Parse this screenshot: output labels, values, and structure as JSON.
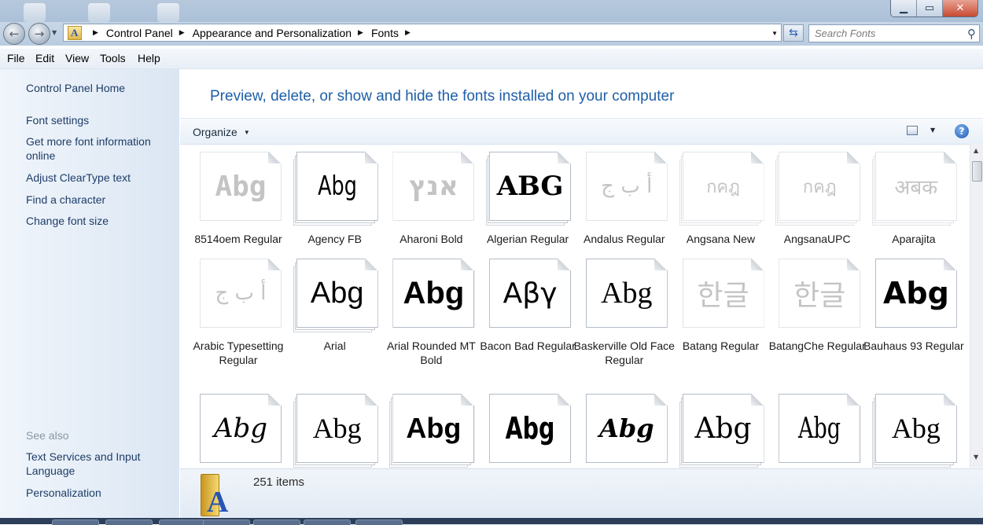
{
  "window_buttons": {
    "minimize": "▁",
    "maximize": "▭",
    "close": "✕"
  },
  "nav": {
    "back_glyph": "←",
    "forward_glyph": "→",
    "breadcrumbs": [
      "Control Panel",
      "Appearance and Personalization",
      "Fonts"
    ],
    "search_placeholder": "Search Fonts"
  },
  "menu": [
    "File",
    "Edit",
    "View",
    "Tools",
    "Help"
  ],
  "sidebar": {
    "home": "Control Panel Home",
    "links": [
      "Font settings",
      "Get more font information online",
      "Adjust ClearType text",
      "Find a character",
      "Change font size"
    ],
    "see_also_label": "See also",
    "see_also": [
      "Text Services and Input Language",
      "Personalization"
    ]
  },
  "main": {
    "title": "Preview, delete, or show and hide the fonts installed on your computer",
    "organize_label": "Organize",
    "help_glyph": "?"
  },
  "fonts": [
    {
      "name": "8514oem Regular",
      "sample": "Abg",
      "faded": true,
      "family": "\"DejaVu Sans Mono\", monospace",
      "size": 36,
      "weight": "bold",
      "style": "normal",
      "stack": false
    },
    {
      "name": "Agency FB",
      "sample": "Abg",
      "faded": false,
      "family": "\"DejaVu Sans\", sans-serif",
      "size": 34,
      "weight": "normal",
      "style": "normal",
      "condensed": true,
      "stack": true
    },
    {
      "name": "Aharoni Bold",
      "sample": "אנץ",
      "faded": true,
      "family": "\"DejaVu Sans\", sans-serif",
      "size": 34,
      "weight": "bold",
      "style": "normal",
      "stack": false
    },
    {
      "name": "Algerian Regular",
      "sample": "ABG",
      "faded": false,
      "family": "\"DejaVu Serif\", serif",
      "size": 34,
      "weight": "bold",
      "style": "normal",
      "stack": true
    },
    {
      "name": "Andalus Regular",
      "sample": "أ ب ج",
      "faded": true,
      "family": "\"DejaVu Serif\", serif",
      "size": 26,
      "weight": "normal",
      "style": "normal",
      "stack": false
    },
    {
      "name": "Angsana New",
      "sample": "กคฎ",
      "faded": true,
      "family": "\"DejaVu Sans\", sans-serif",
      "size": 22,
      "weight": "normal",
      "style": "normal",
      "stack": true
    },
    {
      "name": "AngsanaUPC",
      "sample": "กคฎ",
      "faded": true,
      "family": "\"DejaVu Sans\", sans-serif",
      "size": 22,
      "weight": "normal",
      "style": "normal",
      "stack": true
    },
    {
      "name": "Aparajita",
      "sample": "अबक",
      "faded": true,
      "family": "\"DejaVu Serif\", serif",
      "size": 26,
      "weight": "normal",
      "style": "normal",
      "stack": true
    },
    {
      "name": "Arabic Typesetting Regular",
      "sample": "أ ب ج",
      "faded": true,
      "family": "\"DejaVu Serif\", serif",
      "size": 26,
      "weight": "normal",
      "style": "normal",
      "stack": false
    },
    {
      "name": "Arial",
      "sample": "Abg",
      "faded": false,
      "family": "\"Liberation Sans\", sans-serif",
      "size": 38,
      "weight": "normal",
      "style": "normal",
      "stack": true
    },
    {
      "name": "Arial Rounded MT Bold",
      "sample": "Abg",
      "faded": false,
      "family": "\"Liberation Sans\", sans-serif",
      "size": 40,
      "weight": "bold",
      "style": "normal",
      "stack": false
    },
    {
      "name": "Bacon Bad Regular",
      "sample": "Αβγ",
      "faded": false,
      "family": "\"DejaVu Sans\", sans-serif",
      "size": 36,
      "weight": "normal",
      "style": "normal",
      "stack": false
    },
    {
      "name": "Baskerville Old Face Regular",
      "sample": "Abg",
      "faded": false,
      "family": "\"Liberation Serif\", serif",
      "size": 38,
      "weight": "normal",
      "style": "normal",
      "stack": false
    },
    {
      "name": "Batang Regular",
      "sample": "한글",
      "faded": true,
      "family": "\"DejaVu Sans\", sans-serif",
      "size": 36,
      "weight": "normal",
      "style": "normal",
      "stack": false
    },
    {
      "name": "BatangChe Regular",
      "sample": "한글",
      "faded": true,
      "family": "\"DejaVu Sans\", sans-serif",
      "size": 36,
      "weight": "normal",
      "style": "normal",
      "stack": false
    },
    {
      "name": "Bauhaus 93 Regular",
      "sample": "Abg",
      "faded": false,
      "family": "\"DejaVu Sans\", sans-serif",
      "size": 38,
      "weight": "bold",
      "style": "normal",
      "stack": false
    },
    {
      "name": "",
      "sample": "Abg",
      "faded": false,
      "family": "\"DejaVu Serif\", serif",
      "size": 34,
      "weight": "normal",
      "style": "italic",
      "stack": false
    },
    {
      "name": "",
      "sample": "Abg",
      "faded": false,
      "family": "\"Liberation Serif\", serif",
      "size": 36,
      "weight": "normal",
      "style": "normal",
      "stack": true
    },
    {
      "name": "",
      "sample": "Abg",
      "faded": false,
      "family": "\"Liberation Sans\", sans-serif",
      "size": 36,
      "weight": "bold",
      "style": "normal",
      "stack": true
    },
    {
      "name": "",
      "sample": "Abg",
      "faded": false,
      "family": "\"DejaVu Sans\", sans-serif",
      "size": 38,
      "weight": "bold",
      "style": "normal",
      "condensed": true,
      "stack": false
    },
    {
      "name": "",
      "sample": "Abg",
      "faded": false,
      "family": "\"DejaVu Serif\", serif",
      "size": 32,
      "weight": "bold",
      "style": "italic",
      "stack": false
    },
    {
      "name": "",
      "sample": "Abg",
      "faded": false,
      "family": "\"DejaVu Serif\", serif",
      "size": 36,
      "weight": "normal",
      "style": "normal",
      "stack": true
    },
    {
      "name": "",
      "sample": "Abg",
      "faded": false,
      "family": "\"DejaVu Serif\", serif",
      "size": 36,
      "weight": "normal",
      "style": "normal",
      "condensed": true,
      "stack": false
    },
    {
      "name": "",
      "sample": "Abg",
      "faded": false,
      "family": "\"Liberation Serif\", serif",
      "size": 36,
      "weight": "normal",
      "style": "normal",
      "stack": true
    }
  ],
  "status": {
    "item_count": "251 items"
  },
  "icons": {
    "search": "search-icon",
    "refresh": "refresh-icon",
    "help": "help-icon",
    "folder": "fonts-folder-icon"
  },
  "colors": {
    "title_blue": "#1e5fa8",
    "link_blue": "#1e3d67",
    "sidebar_bg": "#e3ecf6",
    "close_red": "#c74a31"
  }
}
